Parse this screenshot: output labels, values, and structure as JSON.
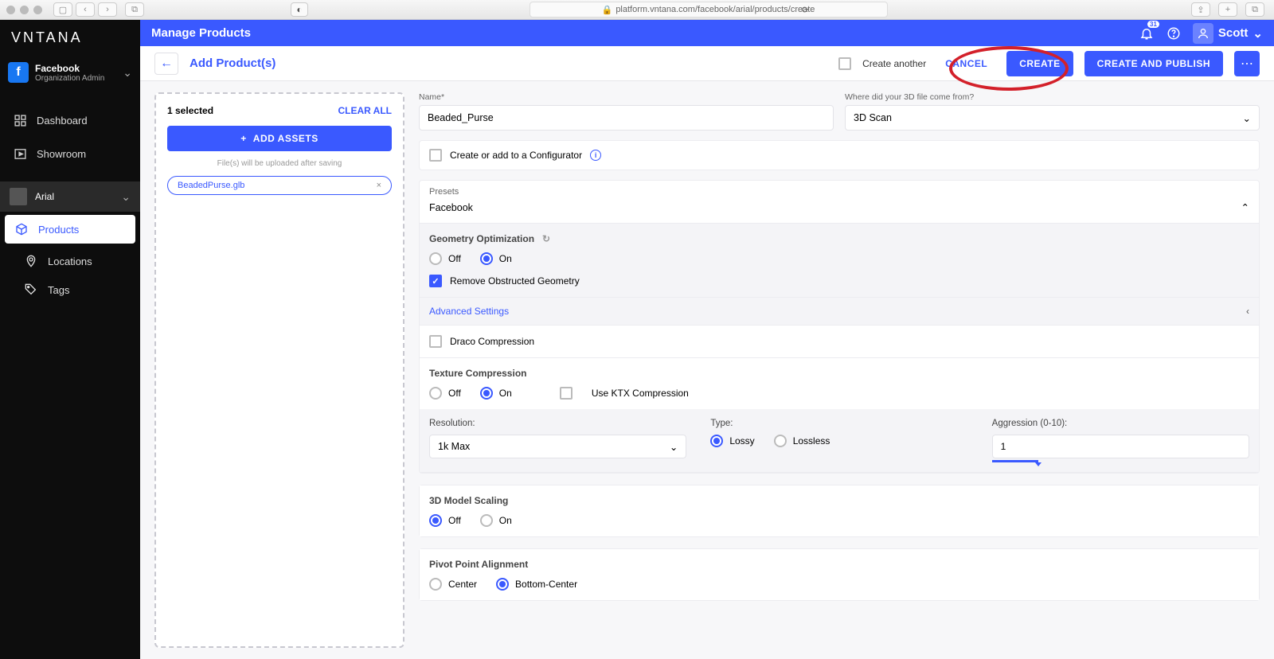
{
  "browser": {
    "url": "platform.vntana.com/facebook/arial/products/create"
  },
  "brand": "VNTANA",
  "org": {
    "name": "Facebook",
    "role": "Organization Admin"
  },
  "nav": {
    "dashboard": "Dashboard",
    "showroom": "Showroom"
  },
  "workspace": {
    "name": "Arial",
    "products": "Products",
    "locations": "Locations",
    "tags": "Tags"
  },
  "header": {
    "title": "Manage Products",
    "notif_count": "31",
    "user": "Scott"
  },
  "actions": {
    "page": "Add Product(s)",
    "create_another": "Create another",
    "cancel": "CANCEL",
    "create": "CREATE",
    "create_publish": "CREATE AND PUBLISH"
  },
  "assets": {
    "selected": "1 selected",
    "clear": "CLEAR ALL",
    "add": "ADD ASSETS",
    "hint": "File(s) will be uploaded after saving",
    "file": "BeadedPurse.glb"
  },
  "form": {
    "name_label": "Name*",
    "name_value": "Beaded_Purse",
    "source_label": "Where did your 3D file come from?",
    "source_value": "3D Scan",
    "configurator": "Create or add to a Configurator",
    "presets_label": "Presets",
    "preset_selected": "Facebook",
    "geom": {
      "title": "Geometry Optimization",
      "off": "Off",
      "on": "On",
      "remove": "Remove Obstructed Geometry"
    },
    "advanced": "Advanced Settings",
    "draco": "Draco Compression",
    "tex": {
      "title": "Texture Compression",
      "off": "Off",
      "on": "On",
      "ktx": "Use KTX Compression",
      "res_label": "Resolution:",
      "res_value": "1k Max",
      "type_label": "Type:",
      "lossy": "Lossy",
      "lossless": "Lossless",
      "agg_label": "Aggression (0-10):",
      "agg_value": "1"
    },
    "scale": {
      "title": "3D Model Scaling",
      "off": "Off",
      "on": "On"
    },
    "pivot": {
      "title": "Pivot Point Alignment",
      "center": "Center",
      "bottom": "Bottom-Center"
    }
  }
}
